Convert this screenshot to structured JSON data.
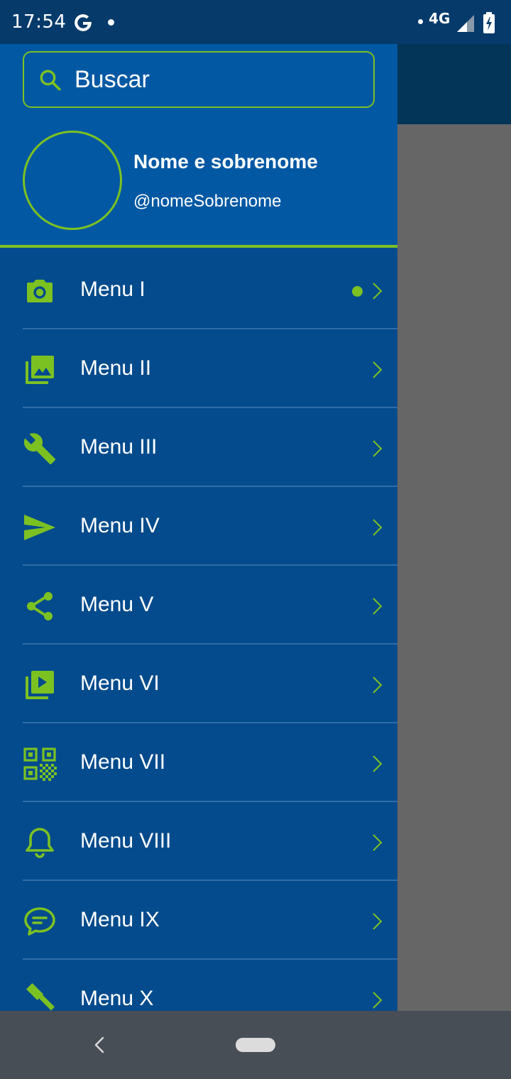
{
  "status_bar": {
    "time": "17:54",
    "network": "4G",
    "g_icon": "google-g-icon",
    "signal_icon": "signal-icon",
    "battery_icon": "battery-charging-icon"
  },
  "drawer": {
    "search": {
      "placeholder": "Buscar",
      "icon": "search-icon"
    },
    "profile": {
      "name": "Nome e sobrenome",
      "handle": "@nomeSobrenome"
    },
    "menu": [
      {
        "label": "Menu I",
        "icon": "camera-icon",
        "badge": true
      },
      {
        "label": "Menu II",
        "icon": "photo-library-icon",
        "badge": false
      },
      {
        "label": "Menu III",
        "icon": "wrench-icon",
        "badge": false
      },
      {
        "label": "Menu IV",
        "icon": "send-icon",
        "badge": false
      },
      {
        "label": "Menu V",
        "icon": "share-icon",
        "badge": false
      },
      {
        "label": "Menu VI",
        "icon": "video-library-icon",
        "badge": false
      },
      {
        "label": "Menu VII",
        "icon": "qr-code-icon",
        "badge": false
      },
      {
        "label": "Menu VIII",
        "icon": "bell-icon",
        "badge": false
      },
      {
        "label": "Menu IX",
        "icon": "chat-bubble-icon",
        "badge": false
      },
      {
        "label": "Menu X",
        "icon": "gavel-icon",
        "badge": false
      }
    ]
  },
  "colors": {
    "accent": "#7cc122",
    "drawer_bg": "#034b8c",
    "header_bg": "#0258a3",
    "status_bar_bg": "#053a6b",
    "scrim": "#666666",
    "nav_bar_bg": "#484e55"
  }
}
